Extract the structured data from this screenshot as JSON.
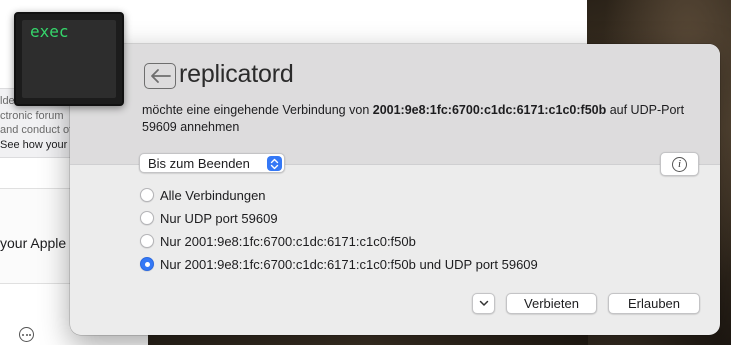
{
  "background": {
    "snippets": [
      "lde",
      "ctronic forum",
      "and conduct of",
      "See how your"
    ],
    "apple_text": "your Apple ..."
  },
  "exec_window": {
    "label": "exec"
  },
  "dialog": {
    "app_name": "replicatord",
    "message_prefix": "möchte eine eingehende Verbindung von ",
    "address": "2001:9e8:1fc:6700:c1dc:6171:c1c0:f50b",
    "message_suffix": " auf UDP-Port 59609 annehmen",
    "duration": {
      "selected": "Bis zum Beenden"
    },
    "options": [
      {
        "label": "Alle Verbindungen",
        "selected": false
      },
      {
        "label": "Nur UDP port 59609",
        "selected": false
      },
      {
        "label": "Nur 2001:9e8:1fc:6700:c1dc:6171:c1c0:f50b",
        "selected": false
      },
      {
        "label": "Nur 2001:9e8:1fc:6700:c1dc:6171:c1c0:f50b und UDP port 59609",
        "selected": true
      }
    ],
    "buttons": {
      "deny": "Verbieten",
      "allow": "Erlauben"
    },
    "icons": {
      "app_icon": "back-arrow-icon",
      "info": "info-icon",
      "expand": "chevron-down-icon",
      "stepper": "up-down-chevron-icon"
    },
    "accent_color": "#3478f6"
  }
}
